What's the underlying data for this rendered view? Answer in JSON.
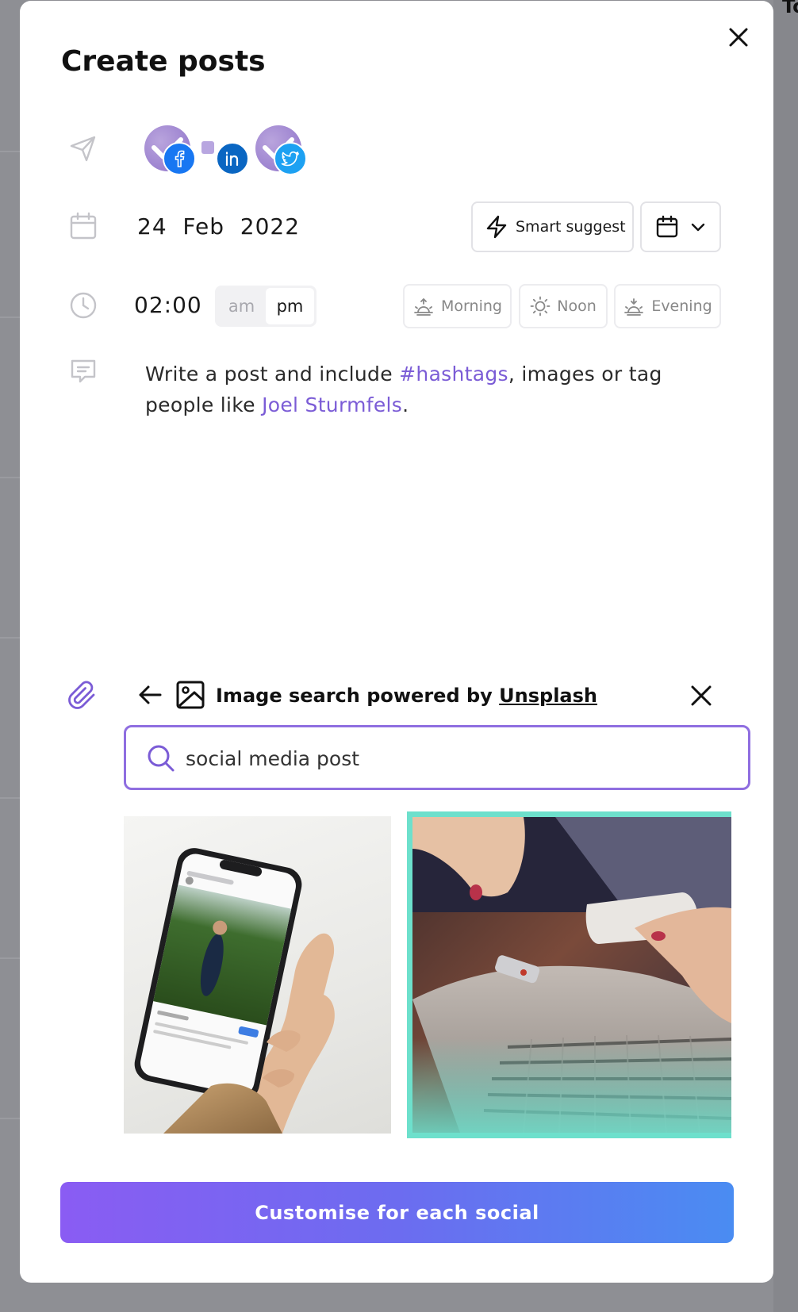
{
  "modal": {
    "title": "Create posts",
    "date": "24  Feb  2022",
    "smart_suggest_label": "Smart suggest",
    "time": "02:00",
    "am_label": "am",
    "pm_label": "pm",
    "selected_period": "pm",
    "slots": {
      "morning": "Morning",
      "noon": "Noon",
      "evening": "Evening"
    },
    "post_text": {
      "part1": "Write a post and include ",
      "hashtag": "#hashtags",
      "part2": ", images or tag people like ",
      "mention": "Joel Sturmfels",
      "part3": "."
    },
    "image_search": {
      "title_prefix": "Image search powered by ",
      "provider": "Unsplash",
      "query": "social media post"
    },
    "cta_label": "Customise for each social"
  },
  "background": {
    "corner_label": "To"
  },
  "colors": {
    "accent": "#7b5cd6",
    "facebook": "#1877f2",
    "linkedin": "#0a66c2",
    "twitter": "#1da1f2",
    "selected_border": "#6de0cc",
    "cta_start": "#8a5cf3",
    "cta_end": "#4a8cf2"
  },
  "accounts": [
    {
      "network": "facebook",
      "icon": "facebook-icon"
    },
    {
      "network": "linkedin",
      "icon": "linkedin-icon"
    },
    {
      "network": "twitter",
      "icon": "twitter-icon"
    }
  ]
}
